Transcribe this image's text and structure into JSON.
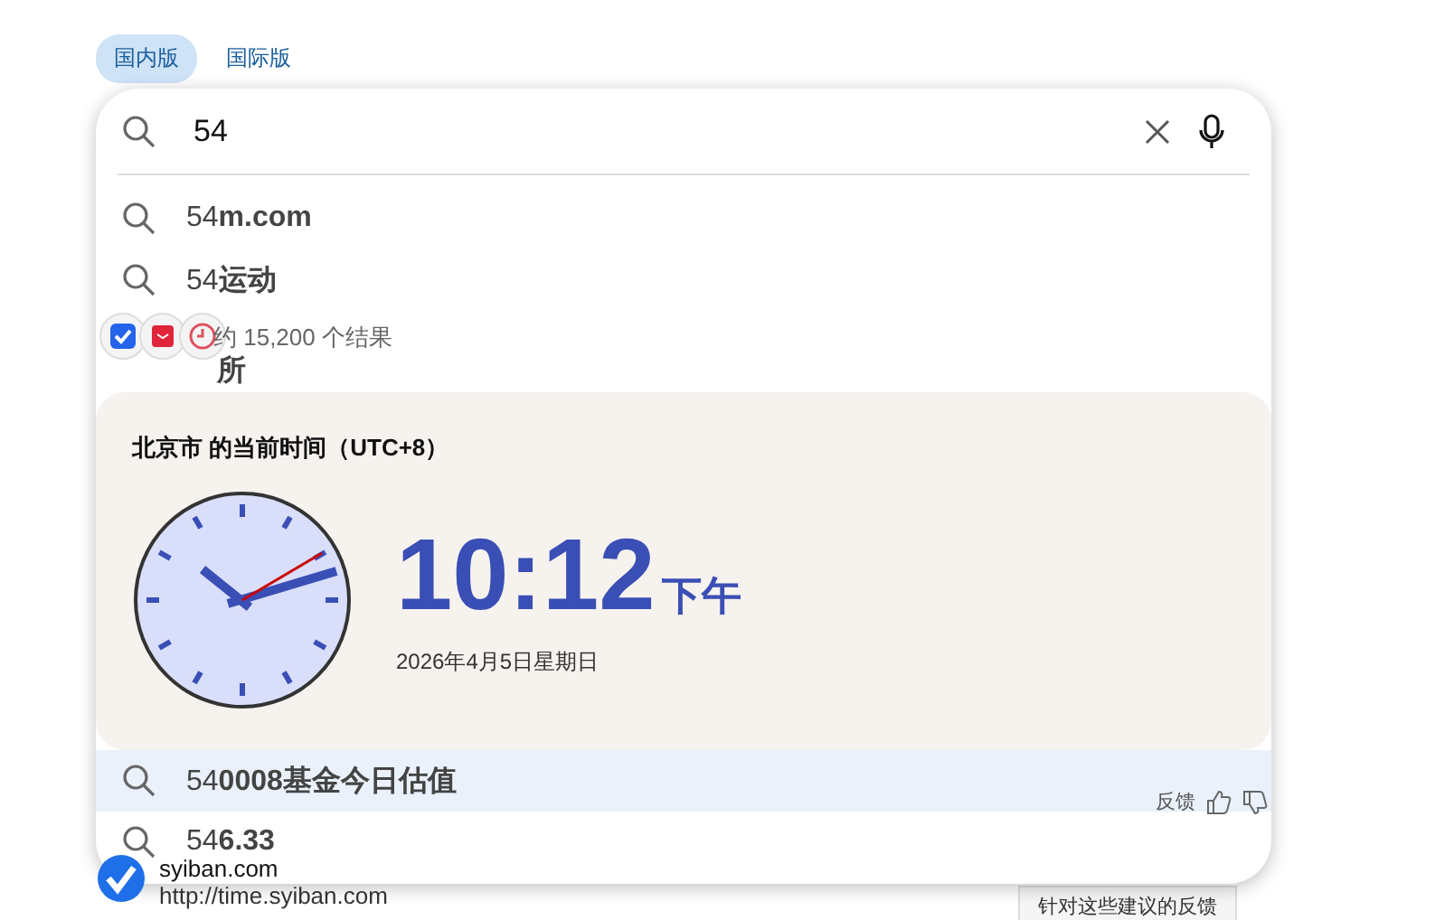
{
  "tabs": [
    {
      "label": "国内版",
      "selected": true
    },
    {
      "label": "国际版",
      "selected": false
    }
  ],
  "search": {
    "value": "54"
  },
  "suggestions_top": [
    {
      "typed": "54",
      "completion": "m.com",
      "selected": false
    },
    {
      "typed": "54",
      "completion": "运动",
      "selected": false
    },
    {
      "completion": "所",
      "selected": false
    }
  ],
  "time_card": {
    "title": "北京市 的当前时间（UTC+8）",
    "time": "10:12",
    "period": "下午",
    "date": "2026年4月5日星期日"
  },
  "suggestions_bottom": [
    {
      "typed": "54",
      "completion": "0008基金今日估值",
      "selected": true
    },
    {
      "typed": "54",
      "completion": "6.33",
      "selected": false
    }
  ],
  "suggestion_feedback": {
    "label": "反馈"
  },
  "results": {
    "count": "约 15,200 个结果",
    "site_name": "syiban.com",
    "url": "http://time.syiban.com",
    "feedback_button": "针对这些建议的反馈"
  }
}
